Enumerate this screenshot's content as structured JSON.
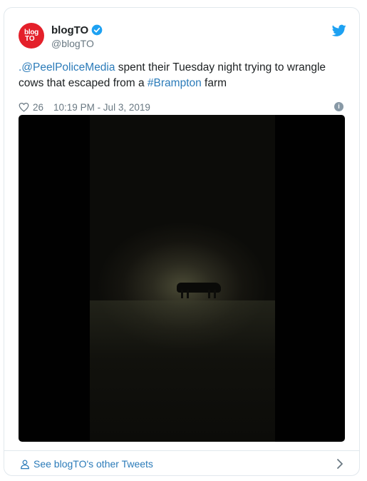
{
  "account": {
    "avatar_line1": "blog",
    "avatar_line2": "TO",
    "display_name": "blogTO",
    "handle": "@blogTO"
  },
  "tweet": {
    "mention": ".@PeelPoliceMedia",
    "text_part1": " spent their Tuesday night trying to wrangle cows that escaped from a ",
    "hashtag": "#Brampton",
    "text_part2": " farm"
  },
  "meta": {
    "like_count": "26",
    "timestamp": "10:19 PM - Jul 3, 2019",
    "info_glyph": "i"
  },
  "footer": {
    "link_label": "See blogTO's other Tweets"
  },
  "colors": {
    "link": "#2b7bb9",
    "brand_red": "#e4202a",
    "twitter_blue": "#1da1f2",
    "muted": "#697882"
  },
  "icons": [
    "verified-badge-icon",
    "twitter-bird-icon",
    "heart-icon",
    "info-icon",
    "person-icon",
    "chevron-right-icon"
  ]
}
